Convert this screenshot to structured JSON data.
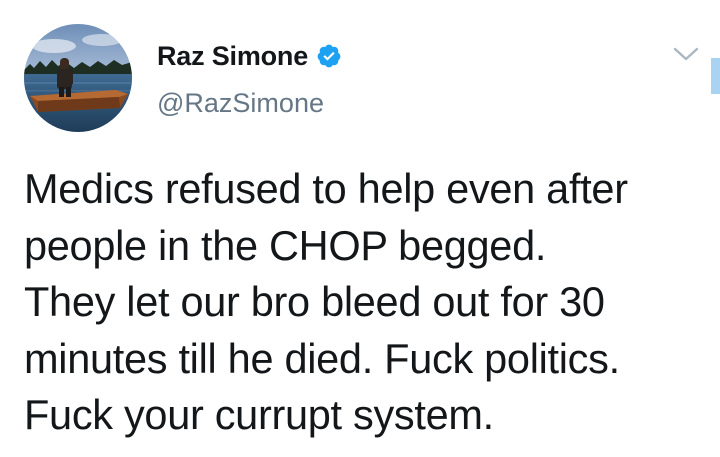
{
  "tweet": {
    "author": {
      "display_name": "Raz Simone",
      "handle": "@RazSimone",
      "verified": true,
      "avatar_icon": "profile-photo-man-standing-in-boat"
    },
    "menu_icon": "chevron-down-icon",
    "text_lines": [
      "Medics refused to help even after",
      "people in the CHOP begged.",
      "They let our bro bleed out for 30",
      "minutes till he died. Fuck politics.",
      "Fuck your currupt system."
    ]
  },
  "colors": {
    "text_primary": "#14171a",
    "text_secondary": "#657786",
    "verified_blue": "#1da1f2",
    "chevron_gray": "#aab8c2",
    "scroll_indicator": "#a9d3f2"
  }
}
